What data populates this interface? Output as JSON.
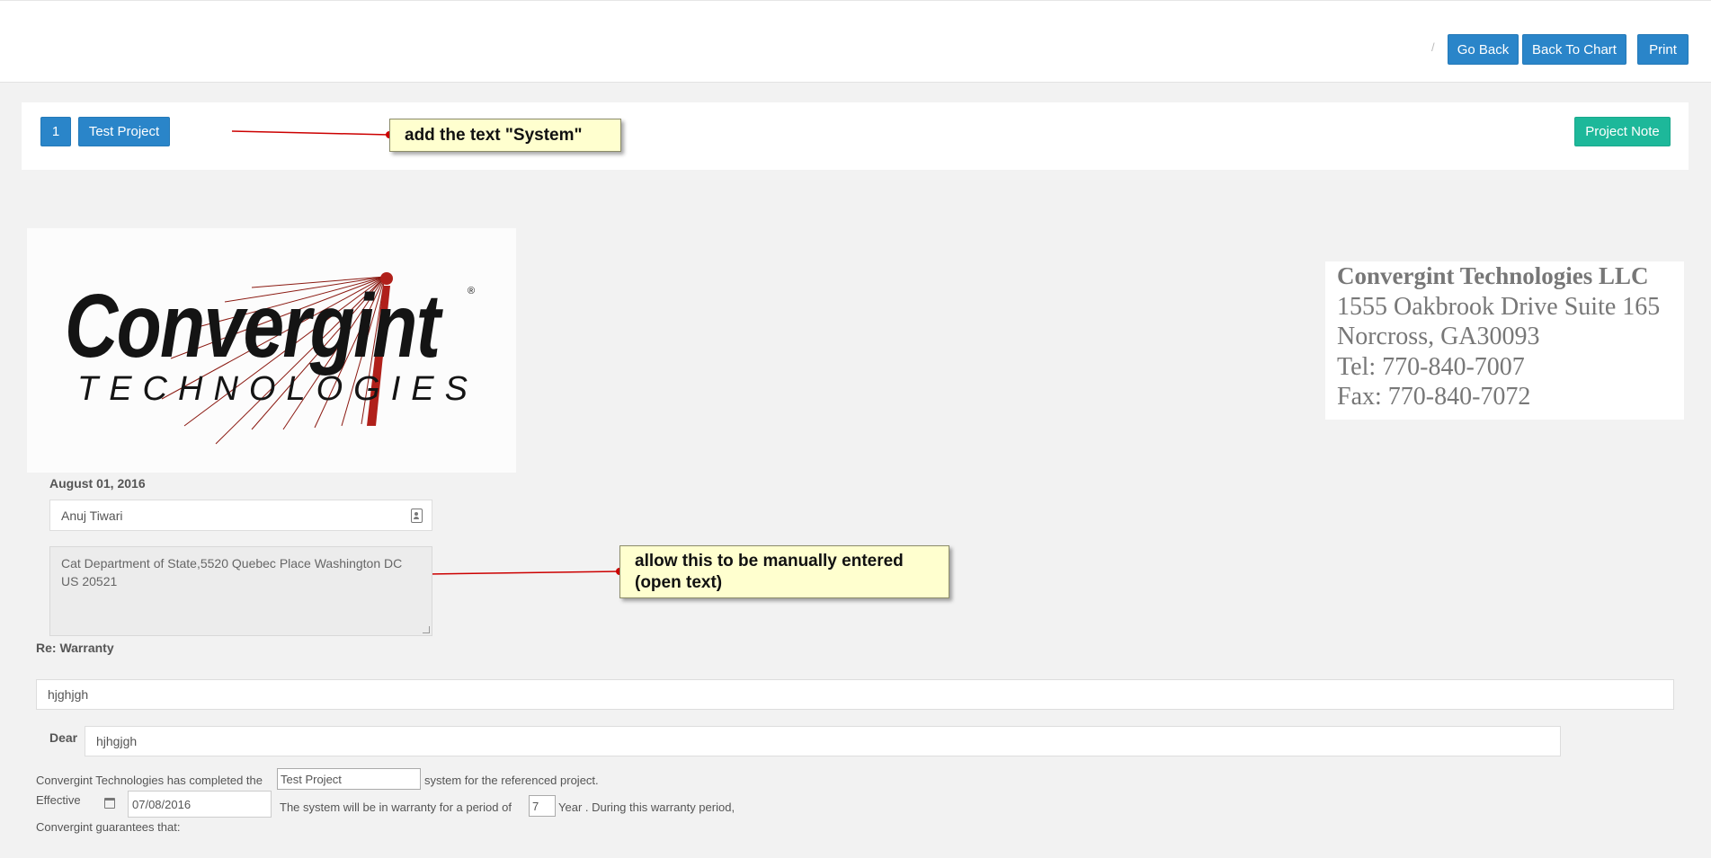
{
  "toolbar": {
    "separator": "/",
    "go_back_label": "Go Back",
    "back_to_chart_label": "Back To Chart",
    "print_label": "Print"
  },
  "project_bar": {
    "number_label": "1",
    "project_label": "Test Project",
    "project_note_label": "Project Note"
  },
  "annotations": {
    "callout_1": "add the text \"System\"",
    "callout_2_line1": "allow this to be manually entered",
    "callout_2_line2": "(open text)"
  },
  "logo": {
    "main_text": "Convergint",
    "sub_text": "TECHNOLOGIES",
    "registered_mark": "®"
  },
  "company_address": {
    "name": "Convergint Technologies LLC",
    "street": "1555 Oakbrook Drive Suite 165",
    "city": "Norcross, GA30093",
    "tel": "Tel: 770-840-7007",
    "fax": "Fax: 770-840-7072"
  },
  "letter": {
    "date": "August 01, 2016",
    "contact_value": "Anuj Tiwari",
    "address_value": "Cat Department of State,5520 Quebec Place Washington DC US 20521",
    "re_label": "Re: Warranty",
    "re_value": "hjghjgh",
    "dear_label": "Dear",
    "dear_value": "hjhgjgh",
    "completed_prefix": "Convergint Technologies has completed the",
    "project_field_value": "Test Project",
    "completed_suffix": "system for the referenced project.",
    "effective_label": "Effective",
    "effective_date_value": "07/08/2016",
    "warranty_prefix": "The system will be in warranty for a period of",
    "warranty_years_value": "7",
    "warranty_suffix": "Year . During this warranty period,",
    "guarantee_text": "Convergint guarantees that:"
  },
  "colors": {
    "primary_button": "#2a85c9",
    "note_button": "#1db89a",
    "callout_bg": "#ffffcf",
    "arrow": "#cc0000",
    "page_bg": "#f2f2f2"
  }
}
